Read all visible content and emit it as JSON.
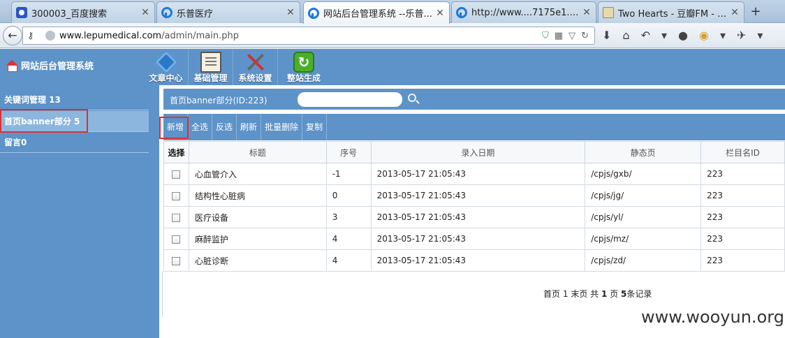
{
  "browser": {
    "tabs": [
      {
        "title": "300003_百度搜索",
        "icon": "baidu-paw-icon",
        "active": false
      },
      {
        "title": "乐普医疗",
        "icon": "lepu-logo-icon",
        "active": false
      },
      {
        "title": "网站后台管理系统 --乐普...",
        "icon": "lepu-logo-icon",
        "active": true
      },
      {
        "title": "http://www....7175e1.php",
        "icon": "lepu-logo-icon",
        "active": false
      },
      {
        "title": "Two Hearts - 豆瓣FM - B...",
        "icon": "douban-icon",
        "active": false
      }
    ],
    "close_glyph": "✕",
    "new_tab_glyph": "+",
    "url_host": "www.lepumedical.com",
    "url_path": "/admin/main.php",
    "back_glyph": "←"
  },
  "admin": {
    "brand": "网站后台管理系统",
    "nav": [
      {
        "label": "文章中心",
        "icon": "article-center-icon"
      },
      {
        "label": "基础管理",
        "icon": "basic-management-icon"
      },
      {
        "label": "系统设置",
        "icon": "system-settings-icon"
      },
      {
        "label": "整站生成",
        "icon": "site-generate-icon"
      }
    ]
  },
  "sidebar": {
    "items": [
      {
        "label": "关键词管理 13"
      },
      {
        "label": "首页banner部分 5"
      },
      {
        "label": "留言0"
      }
    ]
  },
  "content": {
    "title": "首页banner部分(ID:223)",
    "search": {
      "value": "",
      "placeholder": ""
    },
    "toolbar": [
      "新增",
      "全选",
      "反选",
      "刷新",
      "批量删除",
      "复制"
    ],
    "columns": [
      "选择",
      "标题",
      "序号",
      "录入日期",
      "静态页",
      "栏目名ID"
    ],
    "rows": [
      {
        "title": "心血管介入",
        "order": "-1",
        "date": "2013-05-17 21:05:43",
        "page": "/cpjs/gxb/",
        "cat_id": "223"
      },
      {
        "title": "结构性心脏病",
        "order": "0",
        "date": "2013-05-17 21:05:43",
        "page": "/cpjs/jg/",
        "cat_id": "223"
      },
      {
        "title": "医疗设备",
        "order": "3",
        "date": "2013-05-17 21:05:43",
        "page": "/cpjs/yl/",
        "cat_id": "223"
      },
      {
        "title": "麻醉监护",
        "order": "4",
        "date": "2013-05-17 21:05:43",
        "page": "/cpjs/mz/",
        "cat_id": "223"
      },
      {
        "title": "心脏诊断",
        "order": "4",
        "date": "2013-05-17 21:05:43",
        "page": "/cpjs/zd/",
        "cat_id": "223"
      }
    ],
    "pager": {
      "first": "首页",
      "current": "1",
      "last": "末页",
      "total_label": "共",
      "pages": "1",
      "page_unit": "页",
      "records": "5",
      "record_unit": "条记录"
    }
  },
  "watermark": "www.wooyun.org",
  "colors": {
    "admin_blue": "#5d93c8",
    "highlight_red": "#e03030"
  }
}
